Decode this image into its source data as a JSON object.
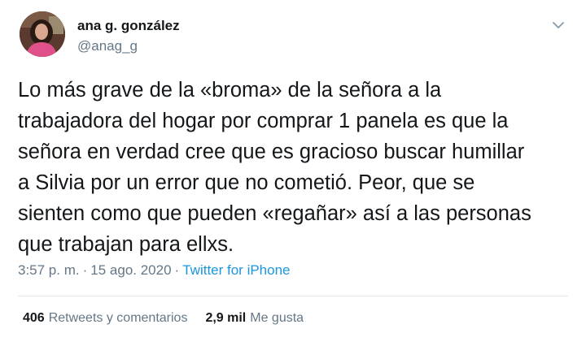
{
  "author": {
    "name": "ana g. gonzález",
    "handle": "@anag_g",
    "avatar_icon": "avatar-photo"
  },
  "tweet": {
    "lines": [
      "Lo más grave de la «broma» de la señora a la",
      "trabajadora del hogar por comprar 1 panela es que la",
      "señora en verdad cree que es gracioso buscar humillar",
      "a Silvia por un error que no cometió. Peor, que se",
      "sienten como que pueden «regañar» así a las personas",
      "que trabajan para ellxs."
    ],
    "time": "3:57 p. m.",
    "separator1": "·",
    "date": "15 ago. 2020",
    "separator2": "·",
    "source": "Twitter for iPhone"
  },
  "stats": {
    "retweets_count": "406",
    "retweets_label": "Retweets y comentarios",
    "likes_count": "2,9 mil",
    "likes_label": "Me gusta"
  },
  "icons": {
    "menu": "chevron-down-icon"
  },
  "colors": {
    "text": "#14171a",
    "secondary": "#657786",
    "link": "#1b95e0",
    "divider": "#e1e8ed"
  }
}
